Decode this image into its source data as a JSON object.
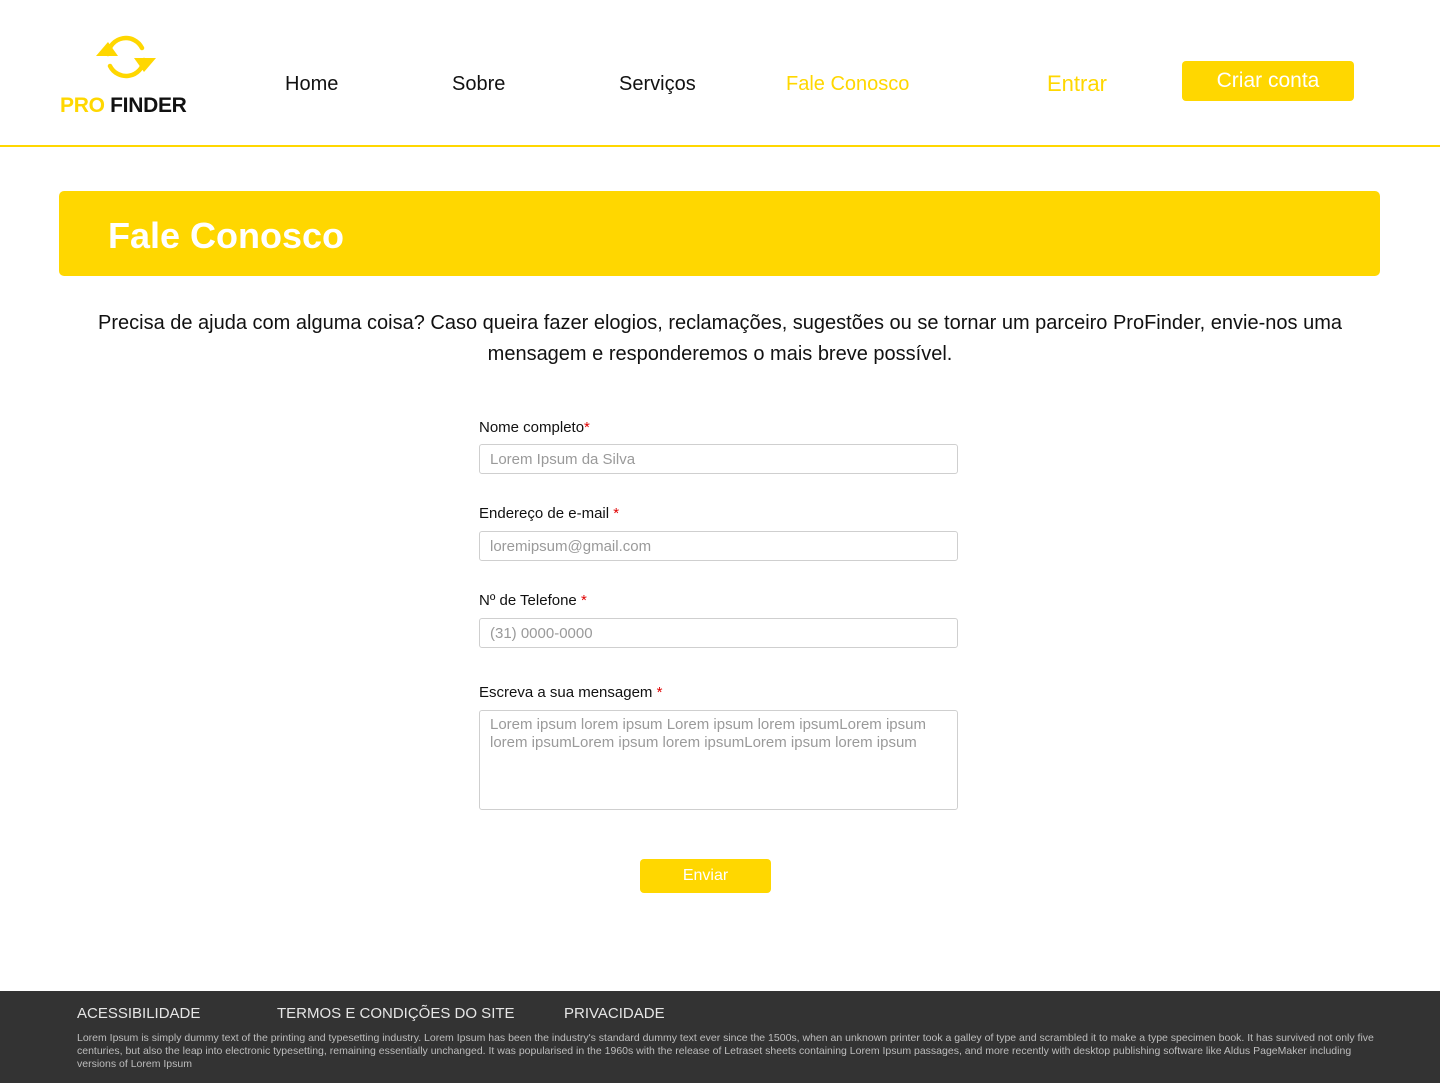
{
  "brand": {
    "logo_pro": "PRO",
    "logo_finder": "FINDER",
    "accent_color": "#FFD700",
    "logo_icon": "refresh-arrows-icon"
  },
  "nav": {
    "items": [
      {
        "label": "Home"
      },
      {
        "label": "Sobre"
      },
      {
        "label": "Serviços"
      },
      {
        "label": "Fale Conosco",
        "active": true
      }
    ],
    "login_label": "Entrar",
    "signup_label": "Criar conta"
  },
  "page": {
    "title": "Fale Conosco",
    "intro": "Precisa de ajuda com alguma coisa? Caso queira fazer elogios, reclamações, sugestões ou se tornar um parceiro ProFinder, envie-nos uma mensagem e responderemos o mais breve possível."
  },
  "form": {
    "required_mark": "*",
    "name": {
      "label": "Nome completo",
      "placeholder": "Lorem Ipsum da Silva",
      "value": ""
    },
    "email": {
      "label": "Endereço de e-mail ",
      "placeholder": "loremipsum@gmail.com",
      "value": ""
    },
    "phone": {
      "label": "Nº de Telefone ",
      "placeholder": "(31) 0000-0000",
      "value": ""
    },
    "message": {
      "label": "Escreva a sua mensagem ",
      "placeholder": "Lorem ipsum lorem ipsum Lorem ipsum lorem ipsumLorem ipsum lorem ipsumLorem ipsum lorem ipsumLorem ipsum lorem ipsum",
      "value": ""
    },
    "submit_label": "Enviar"
  },
  "footer": {
    "links": [
      "ACESSIBILIDADE",
      "TERMOS E CONDIÇÕES DO SITE",
      "PRIVACIDADE"
    ],
    "text": "Lorem Ipsum is simply dummy text of the printing and typesetting industry. Lorem Ipsum has been the industry's standard dummy text ever since the 1500s, when an unknown printer took a galley of type and scrambled it to make a type specimen book. It has survived not only five centuries, but also the leap into electronic typesetting, remaining essentially unchanged. It was popularised in the 1960s with the release of Letraset sheets containing Lorem Ipsum passages, and more recently with desktop publishing software like Aldus PageMaker including versions of Lorem Ipsum"
  }
}
